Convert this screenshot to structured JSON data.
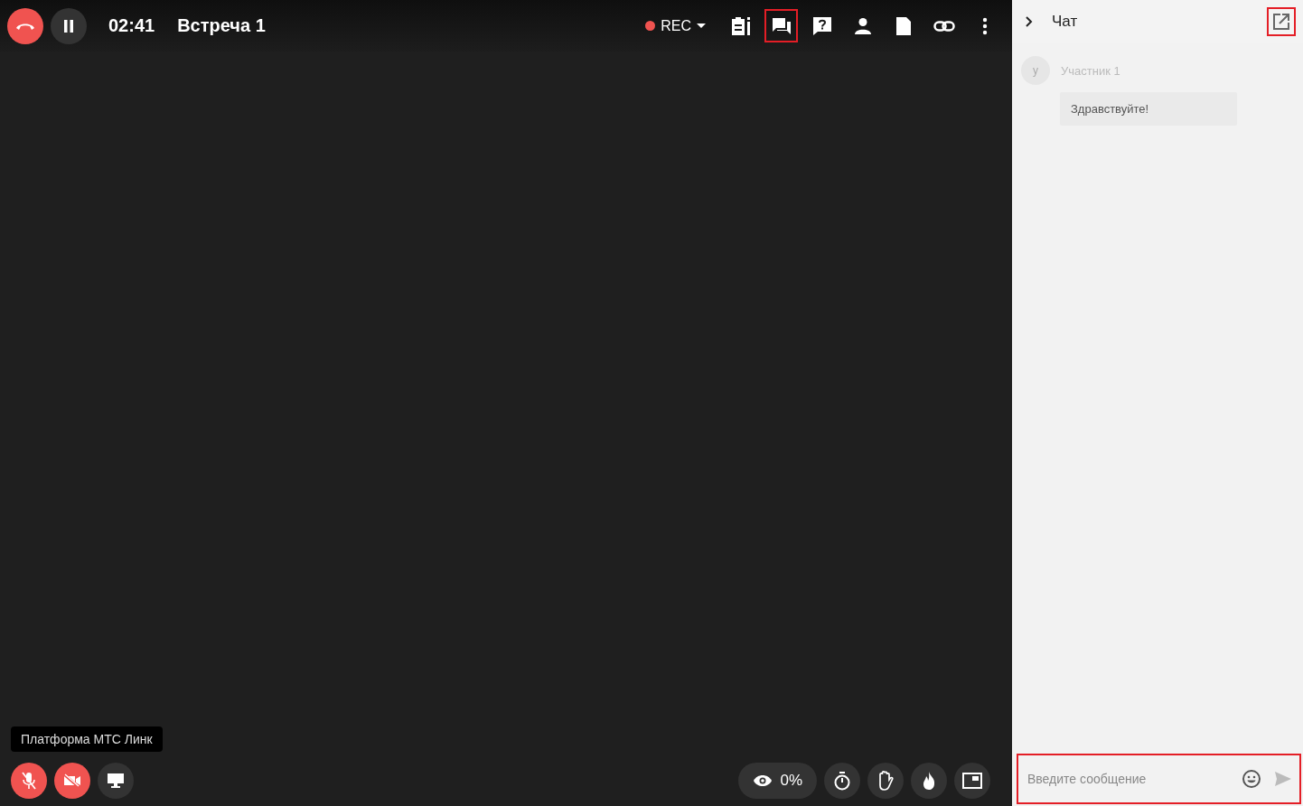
{
  "call": {
    "timer": "02:41",
    "title": "Встреча 1",
    "recording": {
      "label": "REC",
      "active": true
    }
  },
  "toolbar": [
    {
      "kind": "notes",
      "highlighted": false
    },
    {
      "kind": "chat",
      "highlighted": true
    },
    {
      "kind": "questions",
      "highlighted": false
    },
    {
      "kind": "participants",
      "highlighted": false
    },
    {
      "kind": "files",
      "highlighted": false
    },
    {
      "kind": "link",
      "highlighted": false
    },
    {
      "kind": "more",
      "highlighted": false
    }
  ],
  "tooltip": "Платформа МТС Линк",
  "media_controls": [
    {
      "kind": "mic",
      "off": true
    },
    {
      "kind": "camera",
      "off": true
    },
    {
      "kind": "screen",
      "off": false
    }
  ],
  "attention": {
    "label": "0%"
  },
  "tools": [
    {
      "kind": "timer"
    },
    {
      "kind": "hand"
    },
    {
      "kind": "fire"
    },
    {
      "kind": "pip"
    }
  ],
  "chat": {
    "title": "Чат",
    "popout_highlighted": true,
    "messages": [
      {
        "initial": "у",
        "author": "Участник 1",
        "text": "Здравствуйте!"
      }
    ],
    "input": {
      "placeholder": "Введите сообщение",
      "highlighted": true
    }
  }
}
